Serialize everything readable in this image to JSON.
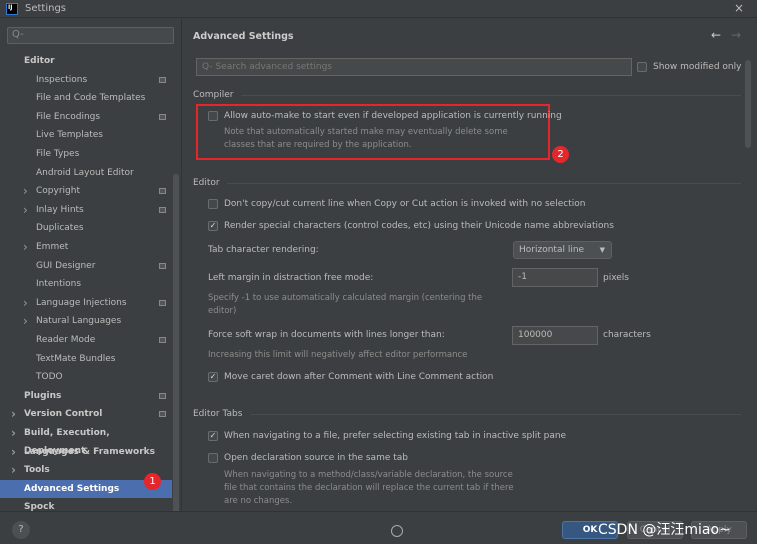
{
  "window": {
    "title": "Settings",
    "close_icon": "×"
  },
  "sidebar": {
    "search_placeholder": "Q-",
    "items": [
      {
        "label": "Editor",
        "level": 0,
        "bold": true
      },
      {
        "label": "Inspections",
        "level": 1,
        "cfg": true
      },
      {
        "label": "File and Code Templates",
        "level": 1
      },
      {
        "label": "File Encodings",
        "level": 1,
        "cfg": true
      },
      {
        "label": "Live Templates",
        "level": 1
      },
      {
        "label": "File Types",
        "level": 1
      },
      {
        "label": "Android Layout Editor",
        "level": 1
      },
      {
        "label": "Copyright",
        "level": 1,
        "arrow": true,
        "cfg": true
      },
      {
        "label": "Inlay Hints",
        "level": 1,
        "arrow": true,
        "cfg": true
      },
      {
        "label": "Duplicates",
        "level": 1
      },
      {
        "label": "Emmet",
        "level": 1,
        "arrow": true
      },
      {
        "label": "GUI Designer",
        "level": 1,
        "cfg": true
      },
      {
        "label": "Intentions",
        "level": 1
      },
      {
        "label": "Language Injections",
        "level": 1,
        "arrow": true,
        "cfg": true
      },
      {
        "label": "Natural Languages",
        "level": 1,
        "arrow": true
      },
      {
        "label": "Reader Mode",
        "level": 1,
        "cfg": true
      },
      {
        "label": "TextMate Bundles",
        "level": 1
      },
      {
        "label": "TODO",
        "level": 1
      },
      {
        "label": "Plugins",
        "level": 0,
        "bold": true,
        "cfg": true
      },
      {
        "label": "Version Control",
        "level": 0,
        "bold": true,
        "arrow": true,
        "cfg": true
      },
      {
        "label": "Build, Execution, Deployment",
        "level": 0,
        "bold": true,
        "arrow": true
      },
      {
        "label": "Languages & Frameworks",
        "level": 0,
        "bold": true,
        "arrow": true
      },
      {
        "label": "Tools",
        "level": 0,
        "bold": true,
        "arrow": true
      },
      {
        "label": "Advanced Settings",
        "level": 0,
        "bold": true,
        "selected": true
      },
      {
        "label": "Spock",
        "level": 0,
        "bold": true
      }
    ],
    "badge": "1"
  },
  "main": {
    "title": "Advanced Settings",
    "search_placeholder": "Search advanced settings",
    "show_modified": "Show modified only",
    "compiler": {
      "header": "Compiler",
      "automake": "Allow auto-make to start even if developed application is currently running",
      "note1": "Note that automatically started make may eventually delete some",
      "note2": "classes that are required by the application.",
      "badge": "2"
    },
    "editor": {
      "header": "Editor",
      "copy_cut": "Don't copy/cut current line when Copy or Cut action is invoked with no selection",
      "render_special": "Render special characters (control codes, etc) using their Unicode name abbreviations",
      "tab_label": "Tab character rendering:",
      "tab_value": "Horizontal line",
      "margin_label": "Left margin in distraction free mode:",
      "margin_value": "-1",
      "margin_unit": "pixels",
      "margin_note1": "Specify -1 to use automatically calculated margin (centering the",
      "margin_note2": "editor)",
      "wrap_label": "Force soft wrap in documents with lines longer than:",
      "wrap_value": "100000",
      "wrap_unit": "characters",
      "wrap_note": "Increasing this limit will negatively affect editor performance",
      "move_caret": "Move caret down after Comment with Line Comment action"
    },
    "tabs": {
      "header": "Editor Tabs",
      "prefer_existing": "When navigating to a file, prefer selecting existing tab in inactive split pane",
      "open_decl": "Open declaration source in the same tab",
      "decl_note1": "When navigating to a method/class/variable declaration, the source",
      "decl_note2": "file that contains the declaration will replace the current tab if there",
      "decl_note3": "are no changes."
    }
  },
  "footer": {
    "help": "?",
    "ok": "OK",
    "cancel": "Cancel",
    "apply": "Apply",
    "watermark": "CSDN @汪汪miao~"
  },
  "colors": {
    "selection": "#4b6eaf",
    "highlight": "#e5262b"
  }
}
